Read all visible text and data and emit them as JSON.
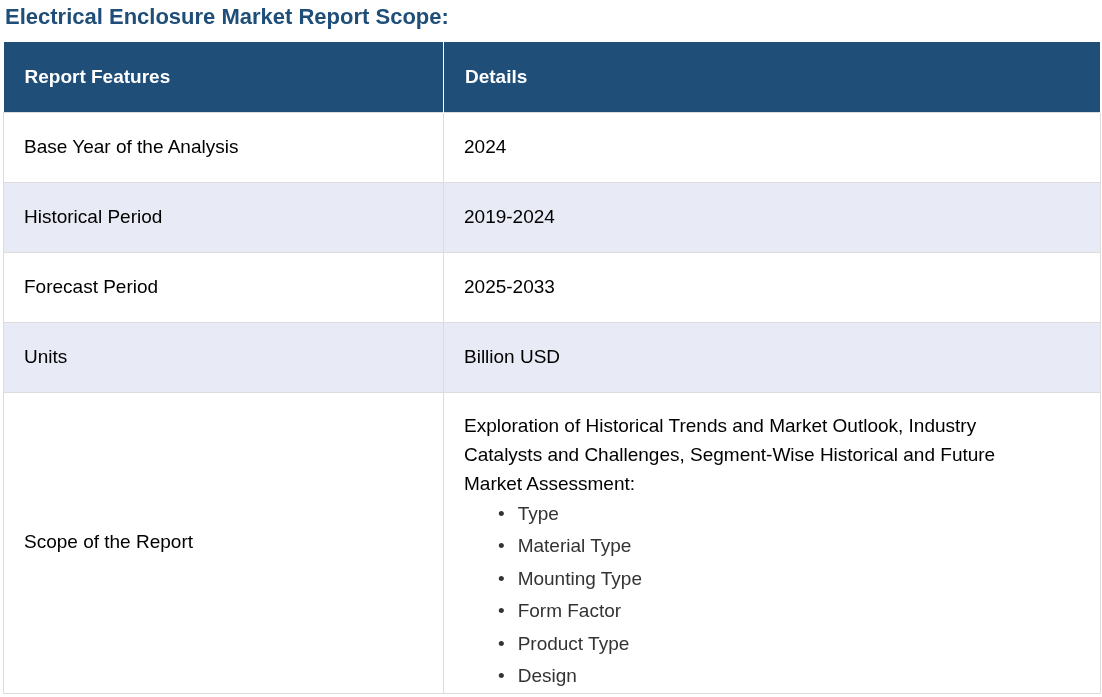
{
  "title": "Electrical Enclosure Market Report Scope:",
  "table": {
    "columns": [
      "Report Features",
      "Details"
    ],
    "rows": [
      {
        "feature": "Base Year of the Analysis",
        "details": "2024"
      },
      {
        "feature": "Historical Period",
        "details": "2019-2024"
      },
      {
        "feature": "Forecast Period",
        "details": "2025-2033"
      },
      {
        "feature": "Units",
        "details": "Billion USD"
      },
      {
        "feature": "Scope of the Report",
        "details": "Exploration of Historical Trends and Market Outlook, Industry Catalysts and Challenges, Segment-Wise Historical and Future Market Assessment:",
        "bullets": [
          {
            "marker": "•",
            "text": "Type"
          },
          {
            "marker": "•",
            "text": "Material Type"
          },
          {
            "marker": "•",
            "text": "Mounting Type"
          },
          {
            "marker": "•",
            "text": "Form Factor"
          },
          {
            "marker": "•",
            "text": "Product Type"
          },
          {
            "marker": "•",
            "text": "Design"
          }
        ]
      }
    ]
  }
}
